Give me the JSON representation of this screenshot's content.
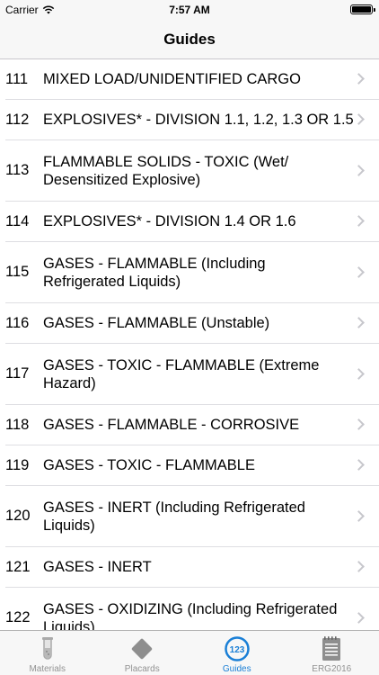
{
  "status": {
    "carrier": "Carrier",
    "time": "7:57 AM"
  },
  "nav": {
    "title": "Guides"
  },
  "guides": [
    {
      "number": "111",
      "name": "MIXED LOAD/UNIDENTIFIED CARGO"
    },
    {
      "number": "112",
      "name": "EXPLOSIVES* - DIVISION 1.1, 1.2, 1.3 OR 1.5"
    },
    {
      "number": "113",
      "name": "FLAMMABLE SOLIDS - TOXIC (Wet/",
      "name2": "Desensitized Explosive)"
    },
    {
      "number": "114",
      "name": "EXPLOSIVES* - DIVISION 1.4 OR 1.6"
    },
    {
      "number": "115",
      "name": "GASES - FLAMMABLE (Including",
      "name2": "Refrigerated Liquids)"
    },
    {
      "number": "116",
      "name": "GASES - FLAMMABLE (Unstable)"
    },
    {
      "number": "117",
      "name": "GASES - TOXIC - FLAMMABLE (Extreme",
      "name2": "Hazard)"
    },
    {
      "number": "118",
      "name": "GASES - FLAMMABLE - CORROSIVE"
    },
    {
      "number": "119",
      "name": "GASES - TOXIC - FLAMMABLE"
    },
    {
      "number": "120",
      "name": "GASES - INERT (Including Refrigerated",
      "name2": "Liquids)"
    },
    {
      "number": "121",
      "name": "GASES - INERT"
    },
    {
      "number": "122",
      "name": "GASES - OXIDIZING (Including Refrigerated",
      "name2": "Liquids)"
    }
  ],
  "tabs": [
    {
      "label": "Materials",
      "icon": "test-tube-icon"
    },
    {
      "label": "Placards",
      "icon": "diamond-placard-icon"
    },
    {
      "label": "Guides",
      "icon": "numbers-123-icon",
      "active": true,
      "badge": "123"
    },
    {
      "label": "ERG2016",
      "icon": "notepad-icon"
    }
  ],
  "colors": {
    "accent": "#1a7fd6",
    "inactive": "#929292",
    "separator": "#dedee2"
  }
}
